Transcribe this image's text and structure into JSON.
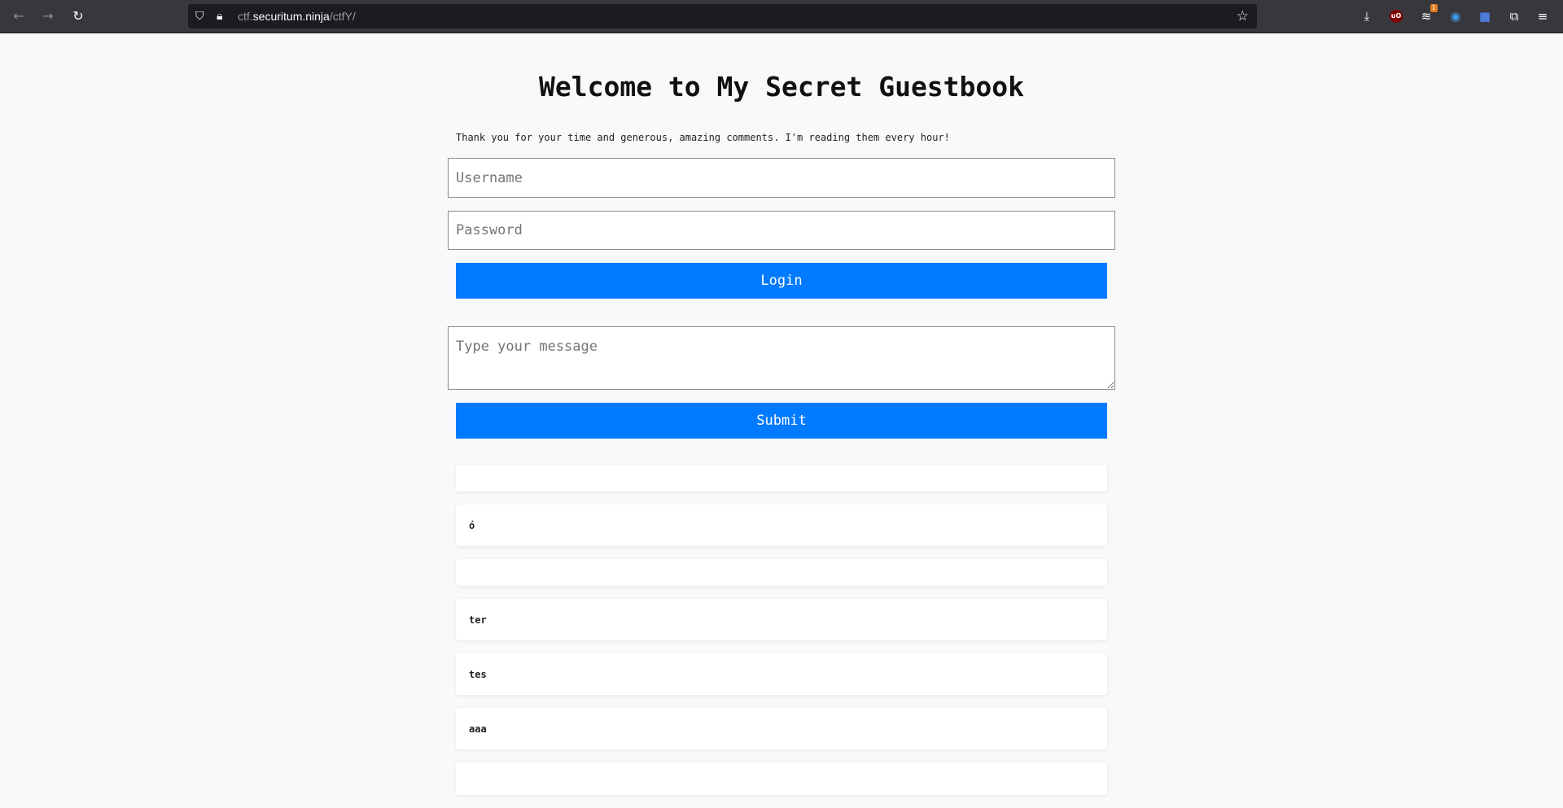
{
  "browser": {
    "url_host_prefix": "ctf.",
    "url_host": "securitum.ninja",
    "url_path": "/ctfY/",
    "extension_badge": "1"
  },
  "page": {
    "title": "Welcome to My Secret Guestbook",
    "intro": "Thank you for your time and generous, amazing comments. I'm reading them every hour!",
    "username_placeholder": "Username",
    "password_placeholder": "Password",
    "login_label": "Login",
    "message_placeholder": "Type your message",
    "submit_label": "Submit",
    "entries": [
      "",
      "ó",
      "",
      "ter",
      "tes",
      "aaa",
      ""
    ]
  },
  "colors": {
    "button_bg": "#007bff",
    "page_bg": "#f8f9fa"
  }
}
